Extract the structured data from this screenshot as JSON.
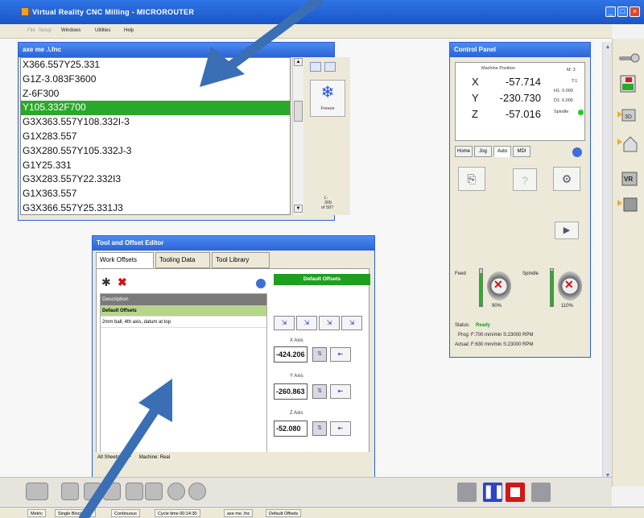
{
  "app": {
    "title": "Virtual Reality CNC Milling - MICROROUTER"
  },
  "menu": {
    "items": [
      {
        "label": "File",
        "dim": true
      },
      {
        "label": "Setup",
        "dim": true
      },
      {
        "label": "Windows",
        "dim": false
      },
      {
        "label": "Utilities",
        "dim": false
      },
      {
        "label": "Help",
        "dim": false
      }
    ]
  },
  "gcode_window": {
    "title": "axe me .\\.fnc",
    "lines": [
      "X366.557Y25.331",
      "G1Z-3.083F3600",
      "Z-6F300",
      "Y105.332F700",
      "G3X363.557Y108.332I-3",
      "G1X283.557",
      "G3X280.557Y105.332J-3",
      "G1Y25.331",
      "G3X283.557Y22.332I3",
      "G1X363.557",
      "G3X366.557Y25.331J3"
    ],
    "selected_index": 3,
    "freeze_label": "Freeze",
    "line_counter": "L: 305",
    "total_counter": "of 587"
  },
  "control_panel": {
    "title": "Control Panel",
    "machine_position_label": "Machine Position",
    "axes": [
      {
        "label": "X",
        "value": "-57.714"
      },
      {
        "label": "Y",
        "value": "-230.730"
      },
      {
        "label": "Z",
        "value": "-57.016"
      }
    ],
    "info": {
      "m": "M: 3",
      "t": "T:1",
      "h1": "H1: 0.000",
      "d1": "D1: 6.000",
      "spindle": "Spindle"
    },
    "tabs": [
      "Home",
      "Jog",
      "Auto",
      "MDI"
    ],
    "active_tab": "Auto",
    "feed_label": "Feed",
    "spindle_label": "Spindle",
    "feed_percent": "90%",
    "spindle_percent": "110%",
    "feed_level": 0.9,
    "spindle_level": 0.95,
    "status_label": "Status:",
    "status_value": "Ready",
    "prog_line": "Prog: F:700 mm/min   S:23000 RPM",
    "actual_line": "Actual: F:630 mm/min   S:23000 RPM"
  },
  "tool_offset_editor": {
    "title": "Tool and Offset Editor",
    "tabs": [
      "Work Offsets",
      "Tooling Data",
      "Tool Library"
    ],
    "active_tab": "Work Offsets",
    "default_offsets_label": "Default Offsets",
    "list_header": "Description",
    "rows": [
      "Default Offsets",
      "2mm ball, 4th axis, datum at top"
    ],
    "x_axis_label": "X Axis",
    "y_axis_label": "Y Axis",
    "z_axis_label": "Z Axis",
    "x_value": "-424.206",
    "y_value": "-260.863",
    "z_value": "-52.080",
    "status_left": "Alt Sheets MDF",
    "status_right": "Machine: Real"
  },
  "statusbar": {
    "cells": [
      "Metric",
      "Single Block OFF",
      "Continuous",
      "Cycle time 00:14:30",
      "axe me .fnc",
      "Default Offsets"
    ]
  },
  "colors": {
    "titlebar": "#1a55c8",
    "accent_green": "#2aa82a",
    "annotation_arrow": "#3a6fb5"
  }
}
